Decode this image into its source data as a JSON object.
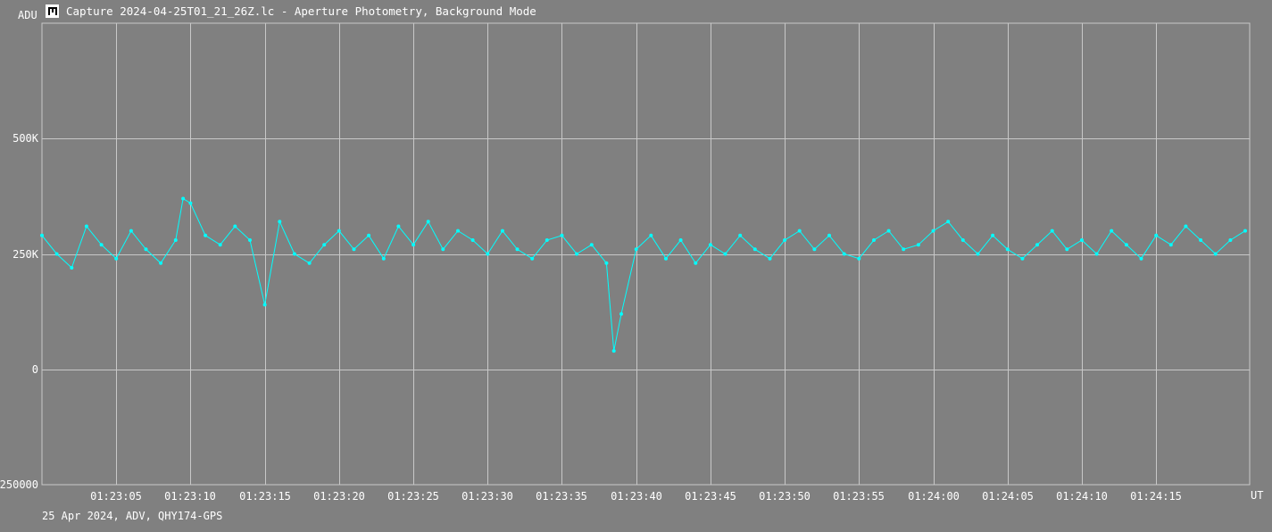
{
  "window": {
    "title": "Capture 2024-04-25T01_21_26Z.lc - Aperture Photometry, Background Mode"
  },
  "footer": {
    "text": "25 Apr 2024, ADV, QHY174-GPS"
  },
  "colors": {
    "background": "#808080",
    "grid": "#c8c8c8",
    "series": "#00ffff",
    "text": "#ffffff"
  },
  "chart_data": {
    "type": "line",
    "title": "",
    "ylabel": "ADU",
    "xlabel": "UT",
    "markers": true,
    "grid": true,
    "ylim": [
      -250000,
      750000
    ],
    "y_ticks": [
      {
        "value": 500000,
        "label": "500K"
      },
      {
        "value": 250000,
        "label": "250K"
      },
      {
        "value": 0,
        "label": "0"
      },
      {
        "value": -250000,
        "label": "-250000"
      }
    ],
    "x_start": "01:23:00",
    "x_end": "01:24:21.3",
    "x_ticks": [
      {
        "value": "01:23:05",
        "label": "01:23:05"
      },
      {
        "value": "01:23:10",
        "label": "01:23:10"
      },
      {
        "value": "01:23:15",
        "label": "01:23:15"
      },
      {
        "value": "01:23:20",
        "label": "01:23:20"
      },
      {
        "value": "01:23:25",
        "label": "01:23:25"
      },
      {
        "value": "01:23:30",
        "label": "01:23:30"
      },
      {
        "value": "01:23:35",
        "label": "01:23:35"
      },
      {
        "value": "01:23:40",
        "label": "01:23:40"
      },
      {
        "value": "01:23:45",
        "label": "01:23:45"
      },
      {
        "value": "01:23:50",
        "label": "01:23:50"
      },
      {
        "value": "01:23:55",
        "label": "01:23:55"
      },
      {
        "value": "01:24:00",
        "label": "01:24:00"
      },
      {
        "value": "01:24:05",
        "label": "01:24:05"
      },
      {
        "value": "01:24:10",
        "label": "01:24:10"
      },
      {
        "value": "01:24:15",
        "label": "01:24:15"
      }
    ],
    "series": [
      {
        "color": "#00ffff",
        "x": [
          "01:23:00.0",
          "01:23:01.0",
          "01:23:02.0",
          "01:23:03.0",
          "01:23:04.0",
          "01:23:05.0",
          "01:23:06.0",
          "01:23:07.0",
          "01:23:08.0",
          "01:23:09.0",
          "01:23:09.5",
          "01:23:10.0",
          "01:23:11.0",
          "01:23:12.0",
          "01:23:13.0",
          "01:23:14.0",
          "01:23:15.0",
          "01:23:16.0",
          "01:23:17.0",
          "01:23:18.0",
          "01:23:19.0",
          "01:23:20.0",
          "01:23:21.0",
          "01:23:22.0",
          "01:23:23.0",
          "01:23:24.0",
          "01:23:25.0",
          "01:23:26.0",
          "01:23:27.0",
          "01:23:28.0",
          "01:23:29.0",
          "01:23:30.0",
          "01:23:31.0",
          "01:23:32.0",
          "01:23:33.0",
          "01:23:34.0",
          "01:23:35.0",
          "01:23:36.0",
          "01:23:37.0",
          "01:23:38.0",
          "01:23:38.5",
          "01:23:39.0",
          "01:23:40.0",
          "01:23:41.0",
          "01:23:42.0",
          "01:23:43.0",
          "01:23:44.0",
          "01:23:45.0",
          "01:23:46.0",
          "01:23:47.0",
          "01:23:48.0",
          "01:23:49.0",
          "01:23:50.0",
          "01:23:51.0",
          "01:23:52.0",
          "01:23:53.0",
          "01:23:54.0",
          "01:23:55.0",
          "01:23:56.0",
          "01:23:57.0",
          "01:23:58.0",
          "01:23:59.0",
          "01:24:00.0",
          "01:24:01.0",
          "01:24:02.0",
          "01:24:03.0",
          "01:24:04.0",
          "01:24:05.0",
          "01:24:06.0",
          "01:24:07.0",
          "01:24:08.0",
          "01:24:09.0",
          "01:24:10.0",
          "01:24:11.0",
          "01:24:12.0",
          "01:24:13.0",
          "01:24:14.0",
          "01:24:15.0",
          "01:24:16.0",
          "01:24:17.0",
          "01:24:18.0",
          "01:24:19.0",
          "01:24:20.0",
          "01:24:21.0"
        ],
        "y": [
          290000,
          250000,
          220000,
          310000,
          270000,
          240000,
          300000,
          260000,
          230000,
          280000,
          370000,
          360000,
          290000,
          270000,
          310000,
          280000,
          140000,
          320000,
          250000,
          230000,
          270000,
          300000,
          260000,
          290000,
          240000,
          310000,
          270000,
          320000,
          260000,
          300000,
          280000,
          250000,
          300000,
          260000,
          240000,
          280000,
          290000,
          250000,
          270000,
          230000,
          40000,
          120000,
          260000,
          290000,
          240000,
          280000,
          230000,
          270000,
          250000,
          290000,
          260000,
          240000,
          280000,
          300000,
          260000,
          290000,
          250000,
          240000,
          280000,
          300000,
          260000,
          270000,
          300000,
          320000,
          280000,
          250000,
          290000,
          260000,
          240000,
          270000,
          300000,
          260000,
          280000,
          250000,
          300000,
          270000,
          240000,
          290000,
          270000,
          310000,
          280000,
          250000,
          280000,
          300000
        ]
      }
    ]
  }
}
